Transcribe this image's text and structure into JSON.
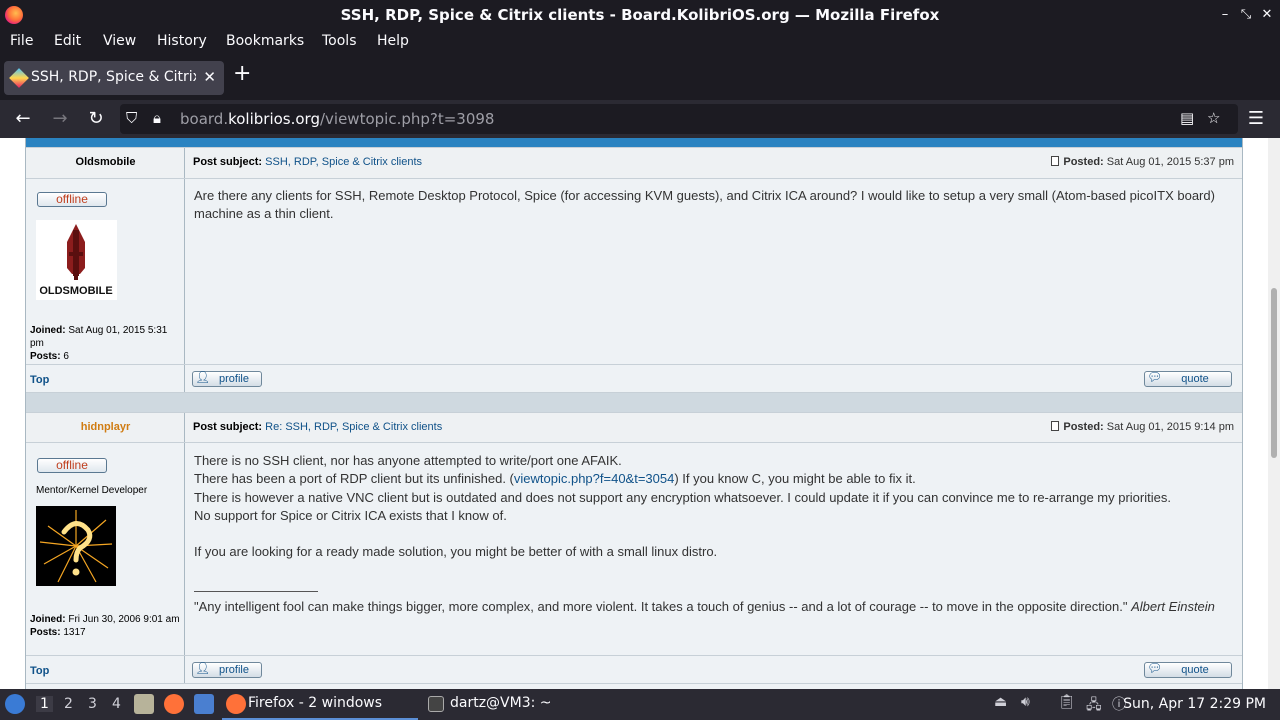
{
  "window": {
    "title": "SSH, RDP, Spice & Citrix clients - Board.KolibriOS.org — Mozilla Firefox",
    "controls": [
      "–",
      "⤡",
      "✕"
    ]
  },
  "menu": [
    "File",
    "Edit",
    "View",
    "History",
    "Bookmarks",
    "Tools",
    "Help"
  ],
  "tab": {
    "label": "SSH, RDP, Spice & Citrix clients",
    "close": "✕",
    "new": "+"
  },
  "url": {
    "prefix": "board.",
    "domain": "kolibrios.org",
    "path": "/viewtopic.php?t=3098"
  },
  "posts": [
    {
      "author": "Oldsmobile",
      "subject_label": "Post subject:",
      "subject": "SSH, RDP, Spice & Citrix clients",
      "posted_label": "Posted:",
      "posted": "Sat Aug 01, 2015 5:37 pm",
      "status": "offline",
      "avatar_text": "OLDSMOBILE",
      "joined_label": "Joined:",
      "joined": "Sat Aug 01, 2015 5:31 pm",
      "posts_label": "Posts:",
      "posts": "6",
      "body": [
        "Are there any clients for SSH, Remote Desktop Protocol, Spice (for accessing KVM guests), and Citrix ICA around? I would like to setup a very small (Atom-based picoITX board)",
        "machine as a thin client."
      ],
      "top": "Top",
      "profile": "profile",
      "quote": "quote"
    },
    {
      "author": "hidnplayr",
      "subject_label": "Post subject:",
      "subject": "Re: SSH, RDP, Spice & Citrix clients",
      "posted_label": "Posted:",
      "posted": "Sat Aug 01, 2015 9:14 pm",
      "status": "offline",
      "rank": "Mentor/Kernel Developer",
      "joined_label": "Joined:",
      "joined": "Fri Jun 30, 2006 9:01 am",
      "posts_label": "Posts:",
      "posts": "1317",
      "body": {
        "l1": "There is no SSH client, nor has anyone attempted to write/port one AFAIK.",
        "l2a": "There has been a port of RDP client but its unfinished. (",
        "l2link": "viewtopic.php?f=40&t=3054",
        "l2b": ") If you know C, you might be able to fix it.",
        "l3": "There is however a native VNC client but is outdated and does not support any encryption whatsoever. I could update it if you can convince me to re-arrange my priorities.",
        "l4": "No support for Spice or Citrix ICA exists that I know of.",
        "l5": "If you are looking for a ready made solution, you might be better of with a small linux distro.",
        "sig_quote": "\"Any intelligent fool can make things bigger, more complex, and more violent. It takes a touch of genius -- and a lot of courage -- to move in the opposite direction.\" ",
        "sig_author": "Albert Einstein"
      },
      "top": "Top",
      "profile": "profile",
      "quote": "quote"
    }
  ],
  "taskbar": {
    "workspaces": [
      "1",
      "2",
      "3",
      "4"
    ],
    "tasks": [
      "Firefox - 2 windows",
      "dartz@VM3: ~"
    ],
    "clock": "Sun, Apr 17  2:29 PM"
  }
}
